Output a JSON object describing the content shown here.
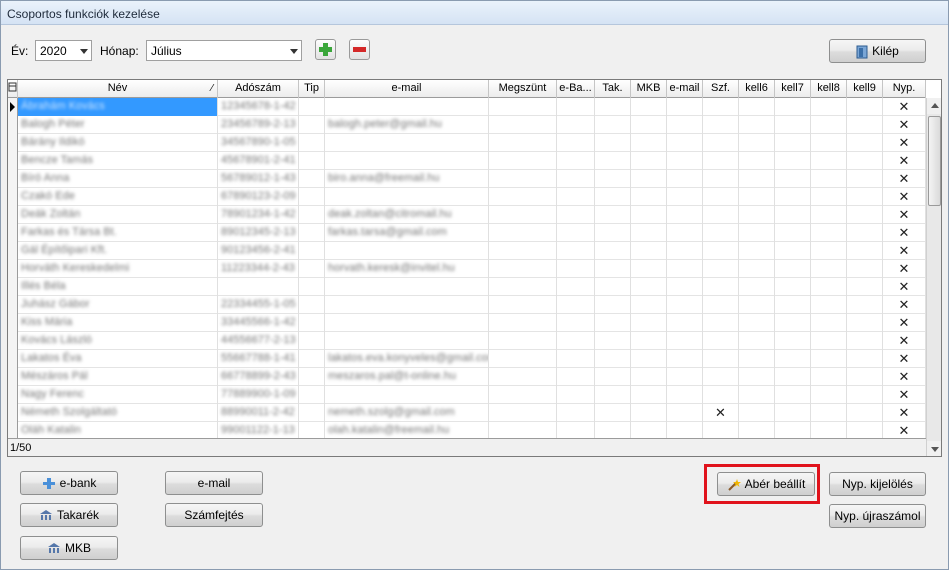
{
  "window": {
    "title": "Csoportos funkciók kezelése"
  },
  "toolbar": {
    "year_label": "Év:",
    "year_value": "2020",
    "month_label": "Hónap:",
    "month_value": "Július",
    "exit_label": "Kilép"
  },
  "grid": {
    "columns": [
      "Név",
      "Adószám",
      "Tip",
      "e-mail",
      "Megszünt",
      "e-Ba...",
      "Tak.",
      "MKB",
      "e-mail",
      "Szf.",
      "kell6",
      "kell7",
      "kell8",
      "kell9",
      "Nyp."
    ],
    "rows": [
      {
        "nev": "Ábrahám Kovács",
        "adoszam": "12345678-1-42",
        "tip": "",
        "email": "",
        "szf": false,
        "nyp": true
      },
      {
        "nev": "Balogh Péter",
        "adoszam": "23456789-2-13",
        "tip": "",
        "email": "balogh.peter@gmail.hu",
        "szf": false,
        "nyp": true
      },
      {
        "nev": "Bárány Ildikó",
        "adoszam": "34567890-1-05",
        "tip": "",
        "email": "",
        "szf": false,
        "nyp": true
      },
      {
        "nev": "Bencze Tamás",
        "adoszam": "45678901-2-41",
        "tip": "",
        "email": "",
        "szf": false,
        "nyp": true
      },
      {
        "nev": "Bíró Anna",
        "adoszam": "56789012-1-43",
        "tip": "",
        "email": "biro.anna@freemail.hu",
        "szf": false,
        "nyp": true
      },
      {
        "nev": "Czakó Ede",
        "adoszam": "67890123-2-09",
        "tip": "",
        "email": "",
        "szf": false,
        "nyp": true
      },
      {
        "nev": "Deák Zoltán",
        "adoszam": "78901234-1-42",
        "tip": "",
        "email": "deak.zoltan@citromail.hu",
        "szf": false,
        "nyp": true
      },
      {
        "nev": "Farkas és Társa Bt.",
        "adoszam": "89012345-2-13",
        "tip": "",
        "email": "farkas.tarsa@gmail.com",
        "szf": false,
        "nyp": true
      },
      {
        "nev": "Gál Építőipari Kft.",
        "adoszam": "90123456-2-41",
        "tip": "",
        "email": "",
        "szf": false,
        "nyp": true
      },
      {
        "nev": "Horváth Kereskedelmi",
        "adoszam": "11223344-2-43",
        "tip": "",
        "email": "horvath.keresk@invitel.hu",
        "szf": false,
        "nyp": true
      },
      {
        "nev": "Illés Béla",
        "adoszam": "",
        "tip": "",
        "email": "",
        "szf": false,
        "nyp": true
      },
      {
        "nev": "Juhász Gábor",
        "adoszam": "22334455-1-05",
        "tip": "",
        "email": "",
        "szf": false,
        "nyp": true
      },
      {
        "nev": "Kiss Mária",
        "adoszam": "33445566-1-42",
        "tip": "",
        "email": "",
        "szf": false,
        "nyp": true
      },
      {
        "nev": "Kovács László",
        "adoszam": "44556677-2-13",
        "tip": "",
        "email": "",
        "szf": false,
        "nyp": true
      },
      {
        "nev": "Lakatos Éva",
        "adoszam": "55667788-1-41",
        "tip": "",
        "email": "lakatos.eva.konyveles@gmail.com",
        "szf": false,
        "nyp": true
      },
      {
        "nev": "Mészáros Pál",
        "adoszam": "66778899-2-43",
        "tip": "",
        "email": "meszaros.pal@t-online.hu",
        "szf": false,
        "nyp": true
      },
      {
        "nev": "Nagy Ferenc",
        "adoszam": "77889900-1-09",
        "tip": "",
        "email": "",
        "szf": false,
        "nyp": true
      },
      {
        "nev": "Németh Szolgáltató",
        "adoszam": "88990011-2-42",
        "tip": "",
        "email": "nemeth.szolg@gmail.com",
        "szf": true,
        "nyp": true
      },
      {
        "nev": "Oláh Katalin",
        "adoszam": "99001122-1-13",
        "tip": "",
        "email": "olah.katalin@freemail.hu",
        "szf": false,
        "nyp": true
      }
    ],
    "status": "1/50"
  },
  "actions": {
    "ebank_label": "e-bank",
    "email_label": "e-mail",
    "takarek_label": "Takarék",
    "szamfejtes_label": "Számfejtés",
    "mkb_label": "MKB",
    "aber_label": "Abér beállít",
    "nyp_kijeloles_label": "Nyp. kijelölés",
    "nyp_ujraszamol_label": "Nyp. újraszámol"
  },
  "icons": {
    "add": "plus-icon",
    "remove": "minus-icon",
    "exit": "door-icon",
    "ebank": "bank-transfer-icon",
    "takarek": "bank-icon",
    "mkb": "bank-icon",
    "aber": "wand-icon",
    "colmenu": "column-chooser-icon",
    "rowpointer": "row-pointer-icon"
  },
  "colors": {
    "selection": "#3399ff",
    "highlight": "#e0121b",
    "add_green": "#3aa63a",
    "remove_red": "#d42828"
  }
}
